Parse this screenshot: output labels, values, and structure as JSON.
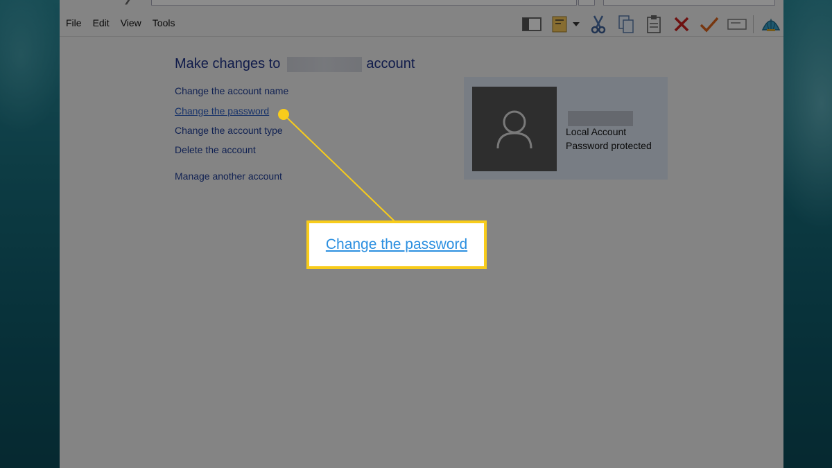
{
  "menu": {
    "items": [
      "File",
      "Edit",
      "View",
      "Tools"
    ]
  },
  "toolbar": {
    "icons": [
      "pane-icon",
      "properties-icon",
      "dropdown-arrow-icon",
      "cut-icon",
      "copy-icon",
      "paste-icon",
      "delete-icon",
      "check-icon",
      "rename-icon",
      "shell-icon"
    ]
  },
  "page": {
    "heading_prefix": "Make changes to",
    "heading_suffix": "account",
    "tasks": [
      "Change the account name",
      "Change the password",
      "Change the account type",
      "Delete the account"
    ],
    "manage_other": "Manage another account"
  },
  "account_tile": {
    "type": "Local Account",
    "status": "Password protected"
  },
  "callout": {
    "label": "Change the password",
    "color": "#f8cc1b"
  }
}
